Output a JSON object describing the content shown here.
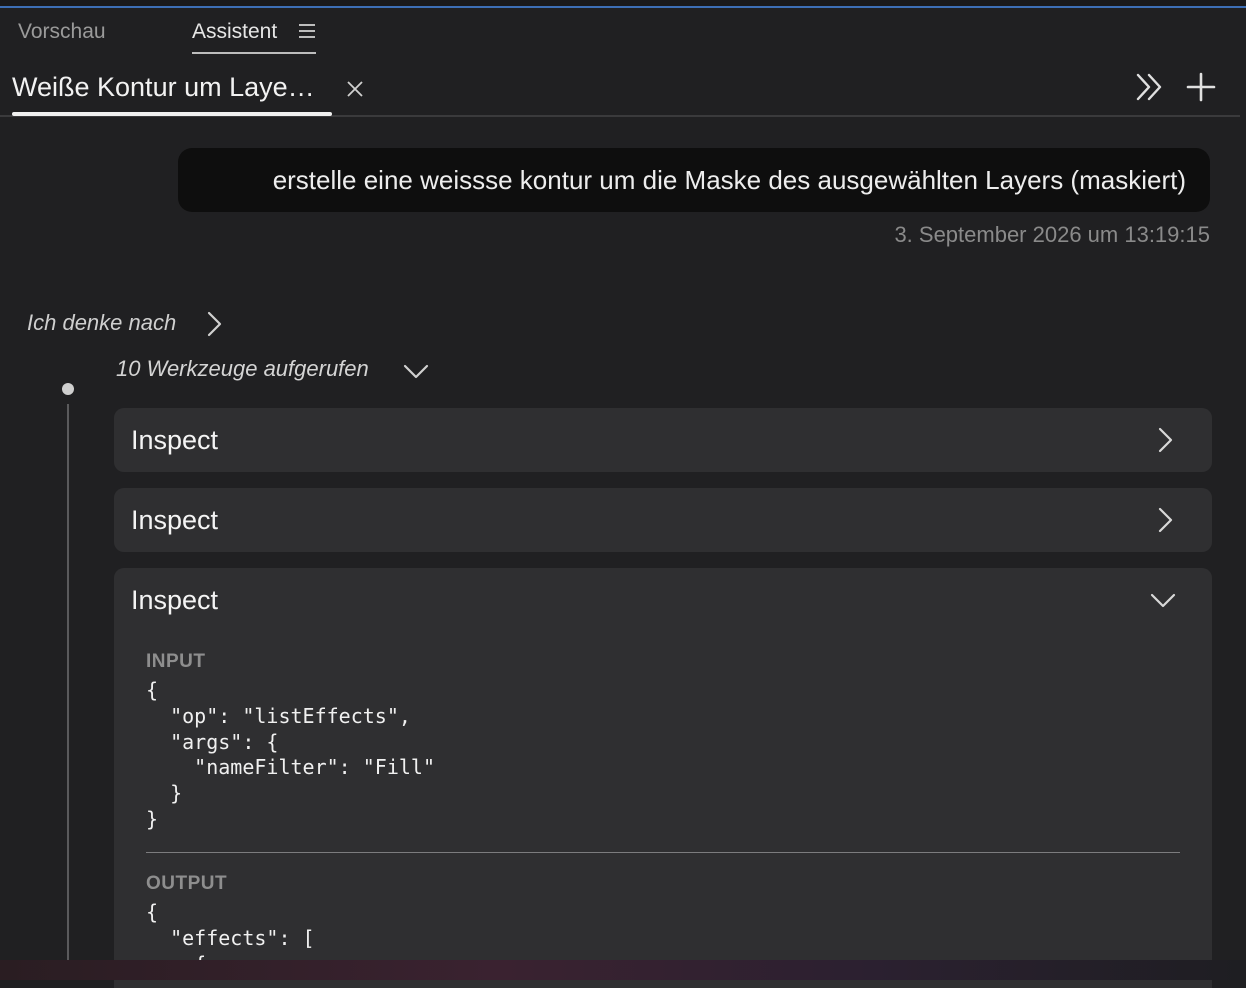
{
  "panel_tabs": {
    "preview": "Vorschau",
    "assistant": "Assistent"
  },
  "conversation": {
    "tab_title": "Weiße Kontur um Laye…"
  },
  "message": {
    "text": "erstelle eine weissse kontur um die Maske des ausgewählten Layers (maskiert)",
    "timestamp": "3. September 2026 um 13:19:15"
  },
  "thinking": {
    "label": "Ich denke nach"
  },
  "tools": {
    "summary": "10 Werkzeuge aufgerufen",
    "cards": [
      {
        "title": "Inspect",
        "state": "collapsed"
      },
      {
        "title": "Inspect",
        "state": "collapsed"
      },
      {
        "title": "Inspect",
        "state": "expanded"
      }
    ],
    "expanded": {
      "input_label": "INPUT",
      "input_code": "{\n  \"op\": \"listEffects\",\n  \"args\": {\n    \"nameFilter\": \"Fill\"\n  }\n}",
      "output_label": "OUTPUT",
      "output_code": "{\n  \"effects\": [\n    {"
    }
  },
  "icons": {
    "menu": "hamburger-menu-icon",
    "close": "close-icon",
    "expand_panel": "double-chevron-right-icon",
    "new_chat": "plus-icon",
    "chevron_right": "chevron-right-icon",
    "chevron_down": "chevron-down-icon"
  },
  "colors": {
    "background": "#202022",
    "card": "#2f2f31",
    "bubble": "#0e0e0e",
    "accent_top": "#3d6fb6"
  }
}
